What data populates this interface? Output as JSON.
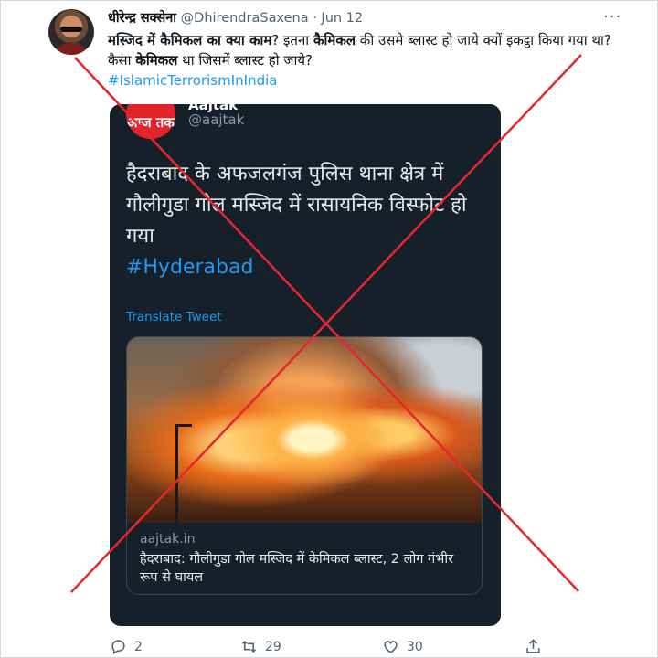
{
  "tweet": {
    "author_name": "धीरेन्द्र सक्सेना",
    "author_handle": "@DhirendraSaxena",
    "separator": "·",
    "date": "Jun 12",
    "more_icon": "more-dots-icon",
    "text_parts": [
      {
        "text": "मस्जिद में कैमिकल का क्या काम",
        "bold": true
      },
      {
        "text": "? इतना ",
        "bold": false
      },
      {
        "text": "कैमिकल",
        "bold": true
      },
      {
        "text": " की उसमे ब्लास्ट हो जाये क्यों इकट्ठा किया गया था? कैसा ",
        "bold": false
      },
      {
        "text": "केमिकल",
        "bold": true
      },
      {
        "text": " था जिसमें ब्लास्ट हो जाये?",
        "bold": false
      }
    ],
    "hashtag": "#IslamicTerrorismInIndia"
  },
  "quoted": {
    "logo_text": "आज तक",
    "name": "Aajtak",
    "handle": "@aajtak",
    "text": "हैदराबाद के अफजलगंज पुलिस थाना क्षेत्र में गौलीगुडा गोल मस्जिद में रासायनिक विस्फोट हो गया",
    "hashtag": "#Hyderabad",
    "translate_label": "Translate Tweet",
    "link": {
      "domain": "aajtak.in",
      "title": "हैदराबाद: गौलीगुडा गोल मस्जिद में केमिकल ब्लास्ट, 2 लोग गंभीर रूप से घायल"
    }
  },
  "actions": {
    "replies": "2",
    "retweets": "29",
    "likes": "30"
  },
  "colors": {
    "accent": "#1d9bf0",
    "cross": "#e8262b",
    "card_bg": "#15202b"
  }
}
